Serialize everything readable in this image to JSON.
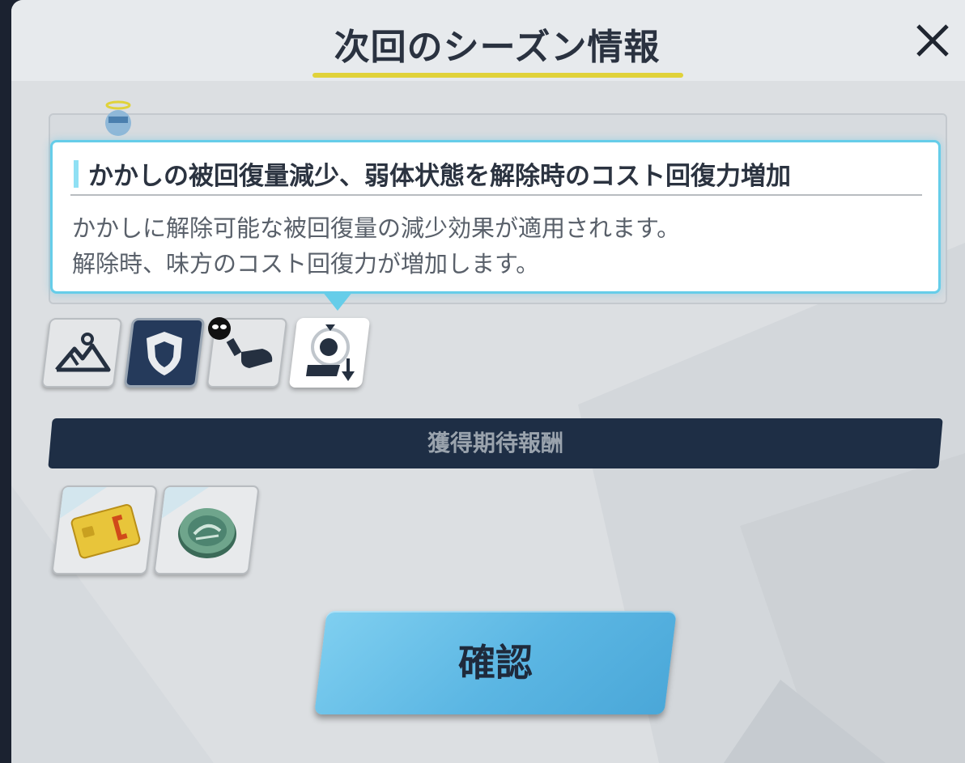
{
  "dialog": {
    "title": "次回のシーズン情報",
    "close_icon": "close-x-icon"
  },
  "tooltip": {
    "title": "かかしの被回復量減少、弱体状態を解除時のコスト回復力増加",
    "description_line1": "かかしに解除可能な被回復量の減少効果が適用されます。",
    "description_line2": "解除時、味方のコスト回復力が増加します。"
  },
  "effects": [
    {
      "icon": "mountain-terrain-icon"
    },
    {
      "icon": "shield-icon"
    },
    {
      "icon": "bullet-icon"
    },
    {
      "icon": "healing-down-icon",
      "selected": true
    }
  ],
  "rewards": {
    "banner_label": "獲得期待報酬",
    "items": [
      {
        "icon": "credit-card-icon"
      },
      {
        "icon": "green-coin-icon"
      }
    ]
  },
  "confirm_button": {
    "label": "確認"
  },
  "colors": {
    "accent_cyan": "#66cde9",
    "title_underline": "#e0d23a",
    "banner_navy": "#1e2e45",
    "confirm_blue": "#5bb6e3"
  }
}
